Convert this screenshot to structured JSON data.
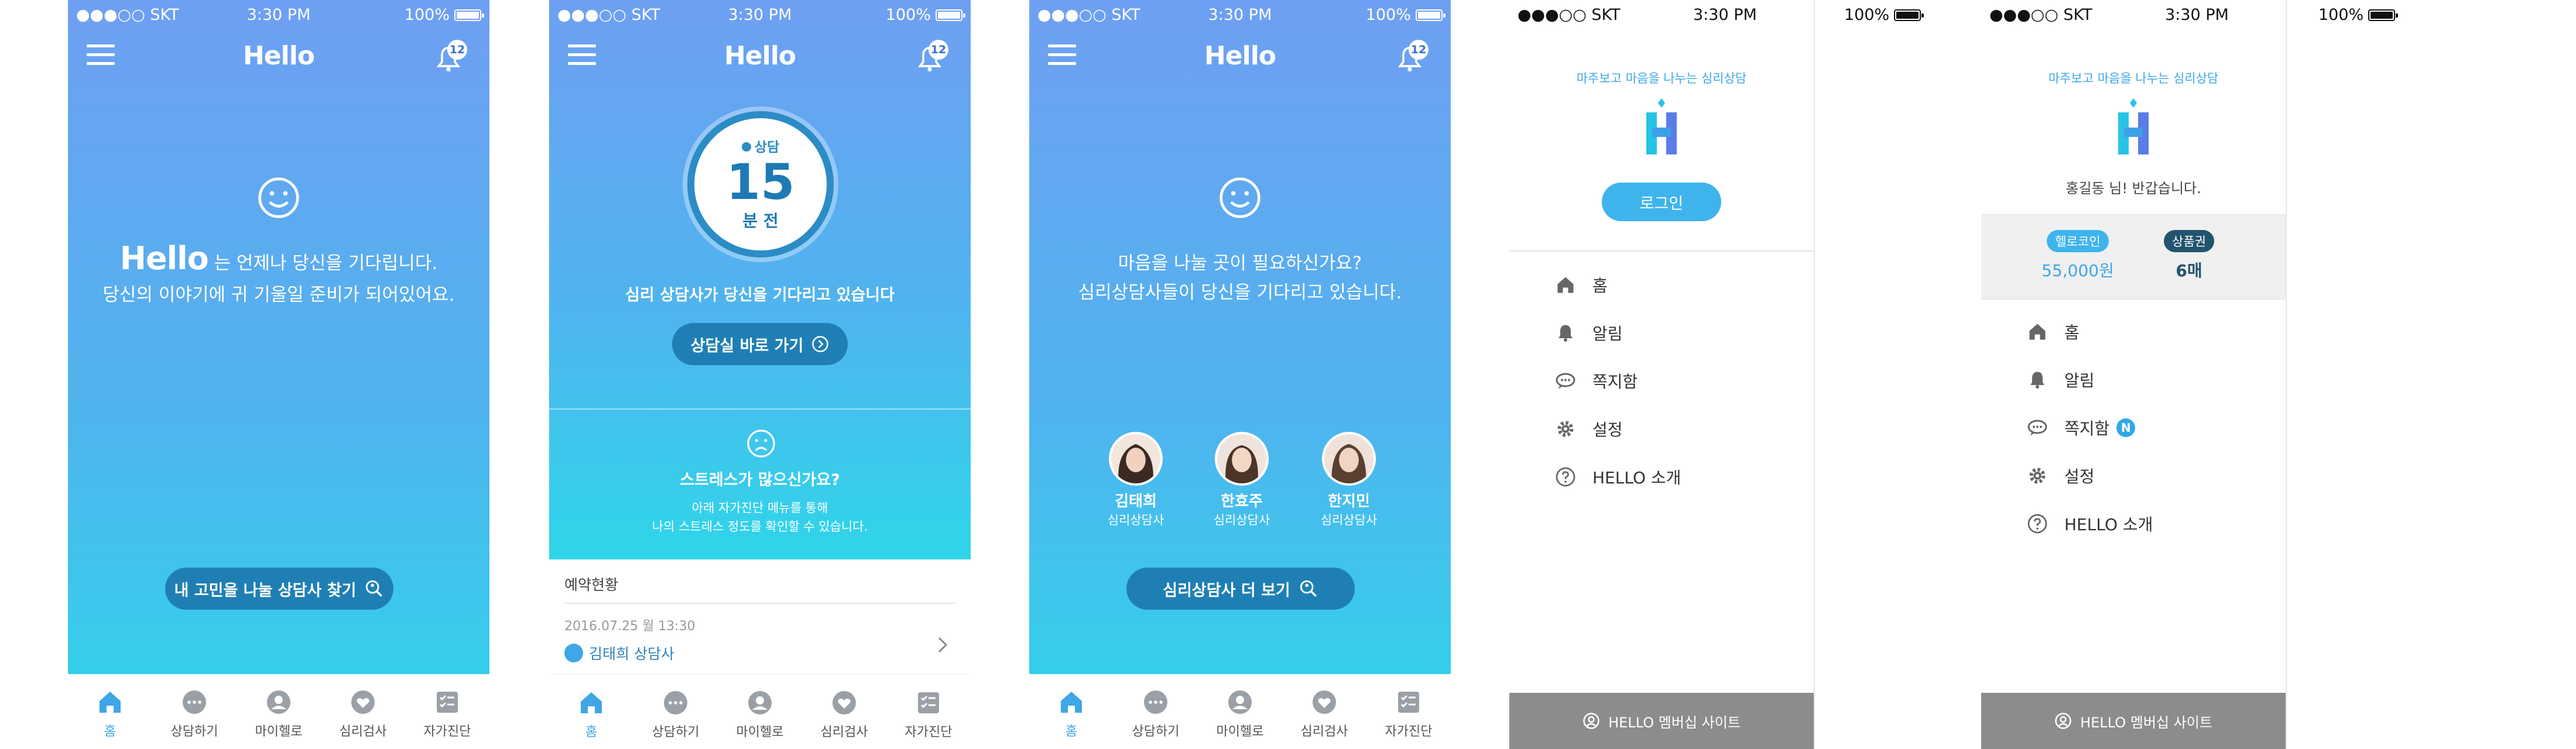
{
  "status": {
    "carrier": "●●●○○ SKT",
    "time": "3:30 PM",
    "battery": "100%"
  },
  "app": {
    "logo": "Hello",
    "notif_count": "12"
  },
  "tabs": [
    {
      "label": "홈",
      "icon": "home-icon"
    },
    {
      "label": "상담하기",
      "icon": "chat-icon"
    },
    {
      "label": "마이헬로",
      "icon": "person-icon"
    },
    {
      "label": "심리검사",
      "icon": "heart-icon"
    },
    {
      "label": "자가진단",
      "icon": "checklist-icon"
    }
  ],
  "screen1": {
    "logo": "Hello",
    "line1": "는 언제나 당신을 기다립니다.",
    "line2": "당신의 이야기에 귀 기울일 준비가 되어있어요.",
    "cta": "내 고민을 나눌 상담사 찾기"
  },
  "screen2": {
    "ring_label": "상담",
    "minutes": "15",
    "unit": "분 전",
    "waiting": "심리 상담사가 당신을 기다리고 있습니다",
    "enter_button": "상담실 바로 가기",
    "stress_title": "스트레스가 많으신가요?",
    "stress_line1": "아래 자가진단 메뉴를 통해",
    "stress_line2": "나의 스트레스 정도를 확인할 수 있습니다.",
    "reservation_header": "예약현황",
    "reservation_date": "2016.07.25 월  13:30",
    "reservation_name": "김태희 상담사"
  },
  "screen3": {
    "line1": "마음을 나눌 곳이 필요하신가요?",
    "line2": "심리상담사들이 당신을 기다리고 있습니다.",
    "counselors": [
      {
        "name": "김태희",
        "role": "심리상담사"
      },
      {
        "name": "한효주",
        "role": "심리상담사"
      },
      {
        "name": "한지민",
        "role": "심리상담사"
      }
    ],
    "more_button": "심리상담사 더 보기"
  },
  "drawer": {
    "tagline": "마주보고 마음을 나누는 심리상담",
    "login_button": "로그인",
    "items": [
      {
        "label": "홈",
        "icon": "home-icon"
      },
      {
        "label": "알림",
        "icon": "bell-icon"
      },
      {
        "label": "쪽지함",
        "icon": "message-icon"
      },
      {
        "label": "설정",
        "icon": "gear-icon"
      },
      {
        "label": "HELLO 소개",
        "icon": "question-icon"
      }
    ],
    "footer": "HELLO 멤버십 사이트"
  },
  "drawer2": {
    "tagline": "마주보고 마음을 나누는 심리상담",
    "greeting": "홍길동 님! 반갑습니다.",
    "coin_label": "헬로코인",
    "coin_value": "55,000원",
    "ticket_label": "상품권",
    "ticket_value": "6매",
    "new_badge": "N",
    "items": [
      {
        "label": "홈",
        "icon": "home-icon"
      },
      {
        "label": "알림",
        "icon": "bell-icon"
      },
      {
        "label": "쪽지함",
        "icon": "message-icon"
      },
      {
        "label": "설정",
        "icon": "gear-icon"
      },
      {
        "label": "HELLO 소개",
        "icon": "question-icon"
      }
    ],
    "footer": "HELLO 멤버십 사이트"
  },
  "colors": {
    "accent": "#3fa6e8",
    "button": "#1f7fb4",
    "gradient_top": "#6f9ff2",
    "gradient_bottom": "#2fd6ea"
  }
}
